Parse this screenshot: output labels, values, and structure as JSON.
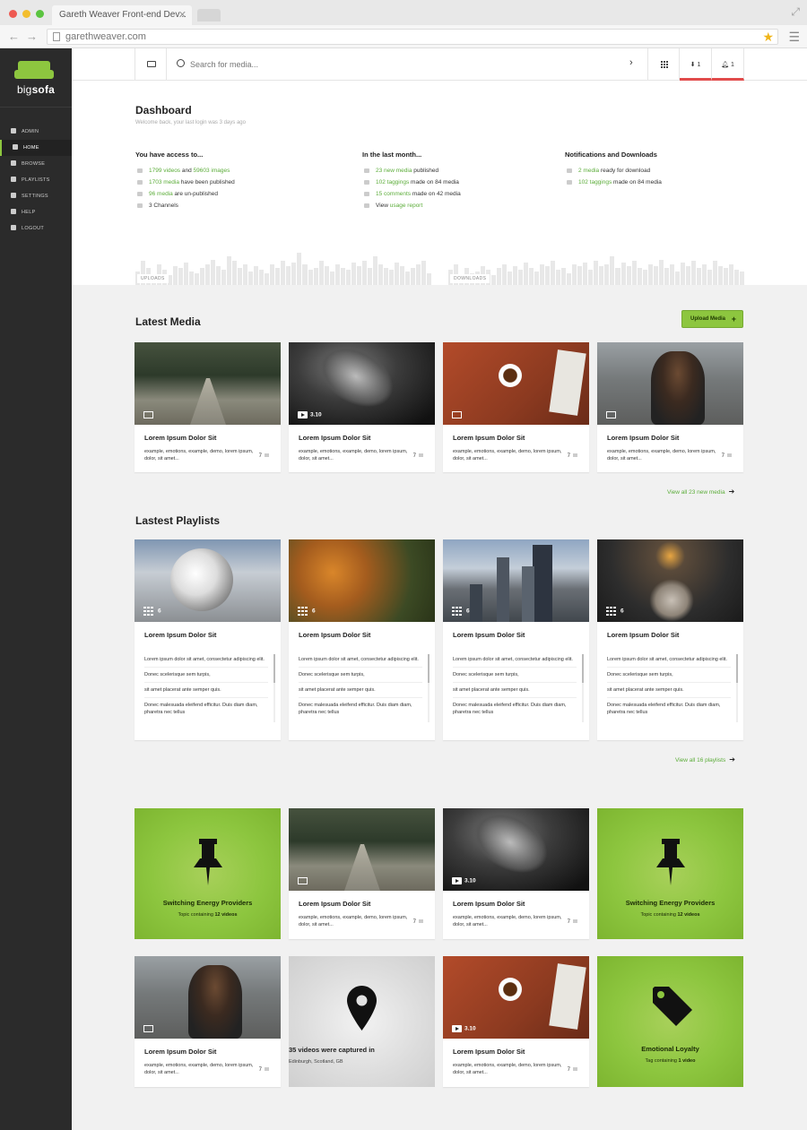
{
  "browser": {
    "tab_title": "Gareth Weaver Front-end Dev...",
    "url": "garethweaver.com"
  },
  "sidebar": {
    "logo_prefix": "big",
    "logo_suffix": "sofa",
    "items": [
      {
        "label": "ADMIN",
        "icon": "edit-icon"
      },
      {
        "label": "HOME",
        "icon": "home-icon",
        "active": true
      },
      {
        "label": "BROWSE",
        "icon": "play-icon"
      },
      {
        "label": "PLAYLISTS",
        "icon": "folder-icon"
      },
      {
        "label": "SETTINGS",
        "icon": "gear-icon"
      },
      {
        "label": "HELP",
        "icon": "help-icon"
      },
      {
        "label": "LOGOUT",
        "icon": "logout-icon"
      }
    ]
  },
  "topbar": {
    "search_placeholder": "Search for media...",
    "downloads_count": "1",
    "notifications_count": "1"
  },
  "dashboard": {
    "title": "Dashboard",
    "subtitle": "Welcome back, your last login was 3 days ago",
    "access": {
      "heading": "You have access to...",
      "rows": [
        {
          "g1": "1799 videos",
          "t1": " and ",
          "g2": "59603 images",
          "t2": ""
        },
        {
          "g1": "1703 media",
          "t1": " have been published",
          "g2": "",
          "t2": ""
        },
        {
          "g1": "96 media",
          "t1": " are un-published",
          "g2": "",
          "t2": ""
        },
        {
          "g1": "",
          "t1": "3 Channels",
          "g2": "",
          "t2": ""
        }
      ]
    },
    "month": {
      "heading": "In the last month...",
      "rows": [
        {
          "g1": "23 new media",
          "t1": " published",
          "g2": "",
          "t2": ""
        },
        {
          "g1": "102 taggings",
          "t1": " made on 84 media",
          "g2": "",
          "t2": ""
        },
        {
          "g1": "15 comments",
          "t1": " made on 42 media",
          "g2": "",
          "t2": ""
        },
        {
          "g1": "",
          "t1": "View ",
          "g2": "usage report",
          "t2": ""
        }
      ]
    },
    "notifications": {
      "heading": "Notifications and Downloads",
      "rows": [
        {
          "g1": "2 media",
          "t1": " ready for download",
          "g2": "",
          "t2": ""
        },
        {
          "g1": "102 taggings",
          "t1": " made on 84 media",
          "g2": "",
          "t2": ""
        }
      ]
    },
    "uploads_label": "UPLOADS",
    "downloads_label": "DOWNLOADS",
    "uploads_levels": [
      0.4,
      0.7,
      0.5,
      0.3,
      0.6,
      0.45,
      0.3,
      0.55,
      0.5,
      0.65,
      0.4,
      0.35,
      0.5,
      0.6,
      0.75,
      0.55,
      0.45,
      0.85,
      0.7,
      0.5,
      0.6,
      0.4,
      0.55,
      0.45,
      0.35,
      0.6,
      0.5,
      0.7,
      0.55,
      0.65,
      0.95,
      0.6,
      0.45,
      0.5,
      0.7,
      0.55,
      0.4,
      0.6,
      0.5,
      0.45,
      0.65,
      0.55,
      0.7,
      0.5,
      0.85,
      0.6,
      0.5,
      0.45,
      0.65,
      0.55,
      0.4,
      0.5,
      0.6,
      0.7,
      0.35
    ],
    "downloads_levels": [
      0.45,
      0.6,
      0.3,
      0.5,
      0.35,
      0.4,
      0.55,
      0.45,
      0.3,
      0.5,
      0.6,
      0.4,
      0.55,
      0.45,
      0.65,
      0.5,
      0.4,
      0.6,
      0.55,
      0.7,
      0.45,
      0.5,
      0.35,
      0.6,
      0.55,
      0.65,
      0.45,
      0.7,
      0.55,
      0.6,
      0.85,
      0.5,
      0.65,
      0.55,
      0.7,
      0.5,
      0.45,
      0.6,
      0.55,
      0.75,
      0.5,
      0.6,
      0.4,
      0.65,
      0.55,
      0.7,
      0.5,
      0.6,
      0.45,
      0.7,
      0.55,
      0.5,
      0.6,
      0.45,
      0.4
    ]
  },
  "latest_media": {
    "title": "Latest Media",
    "upload_label": "Upload Media",
    "view_all": "View all 23 new media",
    "cards": [
      {
        "title": "Lorem Ipsum Dolor Sit",
        "desc": "example, emotions, example, demo, lorem ipsum, dolor, sit amet...",
        "tags": "7",
        "badge": ""
      },
      {
        "title": "Lorem Ipsum Dolor Sit",
        "desc": "example, emotions, example, demo, lorem ipsum, dolor, sit amet...",
        "tags": "7",
        "badge": "3.10"
      },
      {
        "title": "Lorem Ipsum Dolor Sit",
        "desc": "example, emotions, example, demo, lorem ipsum, dolor, sit amet...",
        "tags": "7",
        "badge": ""
      },
      {
        "title": "Lorem Ipsum Dolor Sit",
        "desc": "example, emotions, example, demo, lorem ipsum, dolor, sit amet...",
        "tags": "7",
        "badge": ""
      }
    ]
  },
  "latest_playlists": {
    "title": "Lastest Playlists",
    "view_all": "View all 16 playlists",
    "cards": [
      {
        "title": "Lorem Ipsum Dolor Sit",
        "count": "6",
        "items": [
          "Lorem ipsum dolor sit amet, consectetur adipiscing elit.",
          "Donec scelerisque sem turpis,",
          "sit amet placerat ante semper quis.",
          "Donec malesuada eleifend efficitur. Duis diam diam, pharetra nec tellus"
        ]
      },
      {
        "title": "Lorem Ipsum Dolor Sit",
        "count": "6",
        "items": [
          "Lorem ipsum dolor sit amet, consectetur adipiscing elit.",
          "Donec scelerisque sem turpis,",
          "sit amet placerat ante semper quis.",
          "Donec malesuada eleifend efficitur. Duis diam diam, pharetra nec tellus"
        ]
      },
      {
        "title": "Lorem Ipsum Dolor Sit",
        "count": "6",
        "items": [
          "Lorem ipsum dolor sit amet, consectetur adipiscing elit.",
          "Donec scelerisque sem turpis,",
          "sit amet placerat ante semper quis.",
          "Donec malesuada eleifend efficitur. Duis diam diam, pharetra nec tellus"
        ]
      },
      {
        "title": "Lorem Ipsum Dolor Sit",
        "count": "6",
        "items": [
          "Lorem ipsum dolor sit amet, consectetur adipiscing elit.",
          "Donec scelerisque sem turpis,",
          "sit amet placerat ante semper quis.",
          "Donec malesuada eleifend efficitur. Duis diam diam, pharetra nec tellus"
        ]
      }
    ]
  },
  "tiles": {
    "topic1": {
      "title": "Switching Energy Providers",
      "sub_pre": "Topic containing ",
      "sub_bold": "12 videos"
    },
    "topic2": {
      "title": "Switching Energy Providers",
      "sub_pre": "Topic containing ",
      "sub_bold": "12 videos"
    },
    "media1": {
      "title": "Lorem Ipsum Dolor Sit",
      "desc": "example, emotions, example, demo, lorem ipsum, dolor, sit amet...",
      "tags": "7"
    },
    "media2": {
      "title": "Lorem Ipsum Dolor Sit",
      "desc": "example, emotions, example, demo, lorem ipsum, dolor, sit amet...",
      "tags": "7",
      "badge": "3.10"
    },
    "media3": {
      "title": "Lorem Ipsum Dolor Sit",
      "desc": "example, emotions, example, demo, lorem ipsum, dolor, sit amet...",
      "tags": "7"
    },
    "media4": {
      "title": "Lorem Ipsum Dolor Sit",
      "desc": "example, emotions, example, demo, lorem ipsum, dolor, sit amet...",
      "tags": "7",
      "badge": "3.10"
    },
    "location": {
      "title": "35 videos were captured in",
      "sub": "Edinburgh, Scotland, GB"
    },
    "tag": {
      "title": "Emotional Loyalty",
      "sub_pre": "Tag containing ",
      "sub_bold": "1 video"
    }
  },
  "colors": {
    "accent": "#8dc63f",
    "link": "#5cad3a",
    "alert": "#e14b4b",
    "sidebar": "#2b2b2b"
  }
}
